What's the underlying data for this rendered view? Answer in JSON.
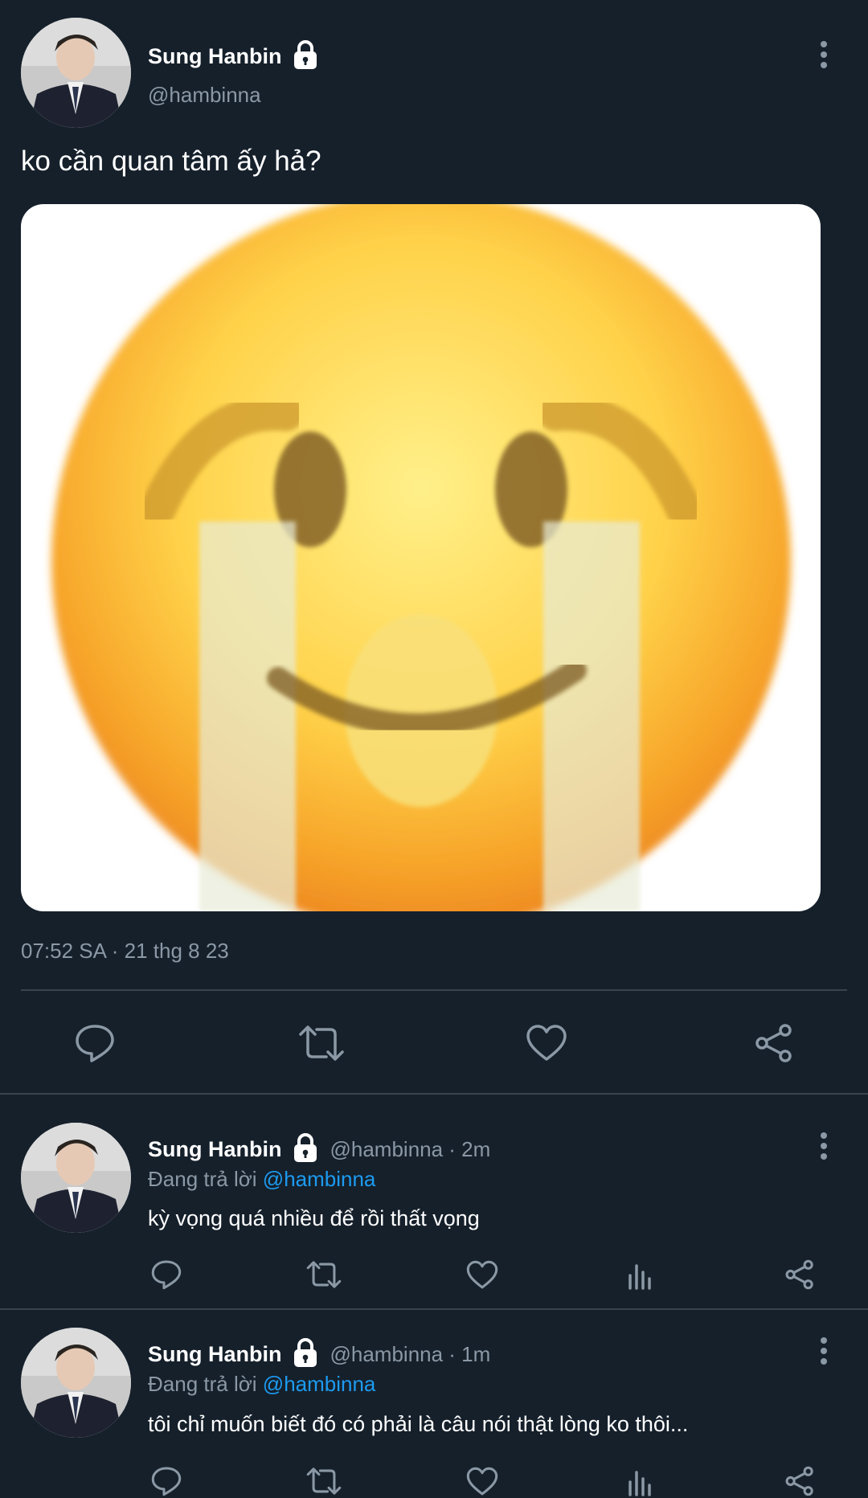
{
  "main_tweet": {
    "author_name": "Sung Hanbin",
    "handle": "@hambinna",
    "text": "ko cần quan tâm ấy hả?",
    "timestamp": "07:52 SA · 21 thg 8 23",
    "image_label": "crying-smile-emoji"
  },
  "replies": [
    {
      "author_name": "Sung Hanbin",
      "handle_time": "@hambinna · 2m",
      "replying_prefix": "Đang trả lời",
      "replying_to": "@hambinna",
      "text": "kỳ vọng quá nhiều để rồi thất vọng"
    },
    {
      "author_name": "Sung Hanbin",
      "handle_time": "@hambinna · 1m",
      "replying_prefix": "Đang trả lời",
      "replying_to": "@hambinna",
      "text": "tôi chỉ muốn biết đó có phải là câu nói thật lòng ko thôi..."
    }
  ],
  "icons": {
    "reply": "reply-icon",
    "retweet": "retweet-icon",
    "like": "like-icon",
    "share": "share-icon",
    "analytics": "analytics-icon",
    "more": "more-vertical-icon",
    "lock": "lock-icon"
  },
  "colors": {
    "background": "#15202b",
    "link": "#1d9bf0",
    "muted": "#8b98a5",
    "divider": "#38444d"
  }
}
